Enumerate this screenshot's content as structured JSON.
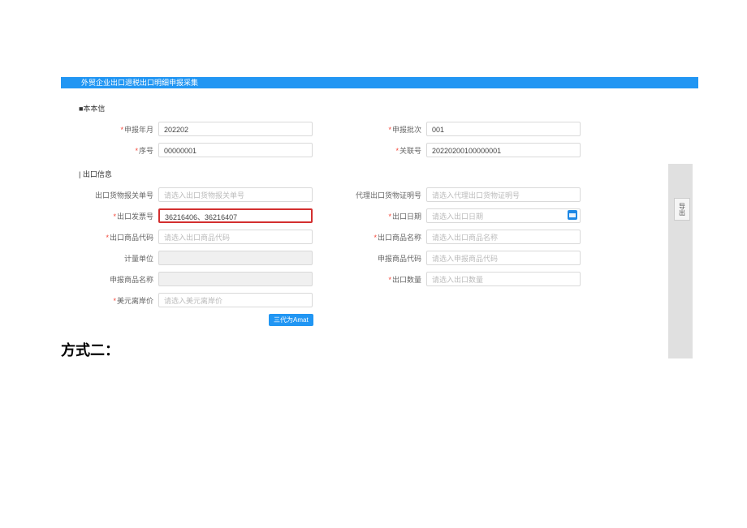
{
  "header": {
    "title": "外贸企业出口退税出口明细申报采集"
  },
  "section1_title": "■本本信",
  "section2_title": "| 出口信息",
  "basic": {
    "year_month": {
      "label": "申报年月",
      "value": "202202"
    },
    "batch": {
      "label": "申报批次",
      "value": "001"
    },
    "seq": {
      "label": "序号",
      "value": "00000001"
    },
    "relation": {
      "label": "关联号",
      "value": "20220200100000001"
    }
  },
  "export": {
    "goods_decl": {
      "label": "出口货物报关单号",
      "placeholder": "请选入出口货物报关单号"
    },
    "agent_doc": {
      "label": "代理出口货物证明号",
      "placeholder": "请选入代理出口货物证明号"
    },
    "invoice": {
      "label": "出口发票号",
      "value": "36216406、36216407"
    },
    "date": {
      "label": "出口日期",
      "placeholder": "请选入出口日期"
    },
    "code": {
      "label": "出口商品代码",
      "placeholder": "请选入出口商品代码"
    },
    "name": {
      "label": "出口商品名称",
      "placeholder": "请选入出口商品名称"
    },
    "unit": {
      "label": "计量单位",
      "value": ""
    },
    "decl_code": {
      "label": "申报商品代码",
      "placeholder": "请选入申报商品代码"
    },
    "decl_name": {
      "label": "申报商品名称",
      "value": ""
    },
    "qty": {
      "label": "出口数量",
      "placeholder": "请选入出口数量"
    },
    "usd_fob": {
      "label": "美元离岸价",
      "placeholder": "请选入美元离岸价"
    }
  },
  "buttons": {
    "save": "三代为Amat",
    "export": "导出"
  },
  "heading2": "方式二："
}
